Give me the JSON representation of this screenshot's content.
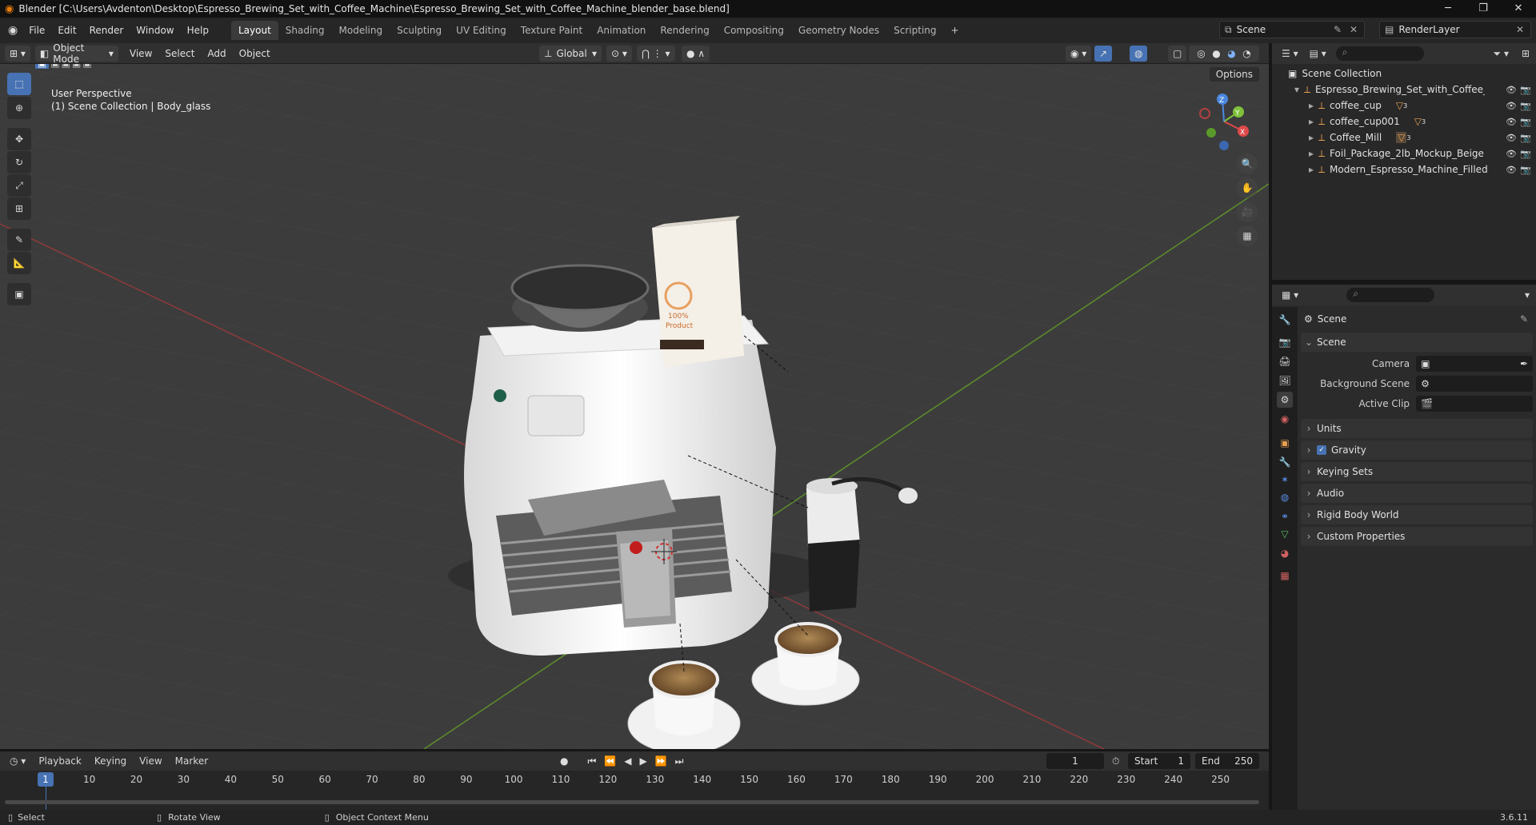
{
  "window": {
    "title": "Blender [C:\\Users\\Avdenton\\Desktop\\Espresso_Brewing_Set_with_Coffee_Machine\\Espresso_Brewing_Set_with_Coffee_Machine_blender_base.blend]",
    "minimize": "─",
    "maximize": "❐",
    "close": "✕"
  },
  "menu": [
    "File",
    "Edit",
    "Render",
    "Window",
    "Help"
  ],
  "workspaces": [
    "Layout",
    "Shading",
    "Modeling",
    "Sculpting",
    "UV Editing",
    "Texture Paint",
    "Animation",
    "Rendering",
    "Compositing",
    "Geometry Nodes",
    "Scripting"
  ],
  "add_workspace": "+",
  "scene": {
    "name": "Scene",
    "view_layer": "RenderLayer"
  },
  "viewport": {
    "mode": "Object Mode",
    "menus": [
      "View",
      "Select",
      "Add",
      "Object"
    ],
    "transform": "Global",
    "options": "Options",
    "perspective": "User Perspective",
    "context": "(1) Scene Collection | Body_glass",
    "gizmo": {
      "x": "X",
      "y": "Y",
      "z": "Z"
    }
  },
  "outliner": {
    "root": "Scene Collection",
    "collection": "Espresso_Brewing_Set_with_Coffee_Mac",
    "items": [
      {
        "name": "coffee_cup",
        "badge": "3"
      },
      {
        "name": "coffee_cup001",
        "badge": "3"
      },
      {
        "name": "Coffee_Mill",
        "badge": "3"
      },
      {
        "name": "Foil_Package_2lb_Mockup_Beige",
        "badge": ""
      },
      {
        "name": "Modern_Espresso_Machine_Filled",
        "badge": ""
      }
    ]
  },
  "properties": {
    "context": "Scene",
    "panel_scene": "Scene",
    "camera_label": "Camera",
    "background_label": "Background Scene",
    "clip_label": "Active Clip",
    "panels": [
      "Units",
      "Gravity",
      "Keying Sets",
      "Audio",
      "Rigid Body World",
      "Custom Properties"
    ],
    "gravity_checked": true
  },
  "timeline": {
    "menus": [
      "Playback",
      "Keying",
      "View",
      "Marker"
    ],
    "current_frame": "1",
    "start_label": "Start",
    "start": "1",
    "end_label": "End",
    "end": "250",
    "ticks": [
      "10",
      "20",
      "30",
      "40",
      "50",
      "60",
      "70",
      "80",
      "90",
      "100",
      "110",
      "120",
      "130",
      "140",
      "150",
      "160",
      "170",
      "180",
      "190",
      "200",
      "210",
      "220",
      "230",
      "240",
      "250"
    ],
    "playhead": "1"
  },
  "status": {
    "select": "Select",
    "rotate": "Rotate View",
    "context_menu": "Object Context Menu",
    "version": "3.6.11"
  },
  "product_label": {
    "line1": "100%",
    "line2": "Product"
  }
}
